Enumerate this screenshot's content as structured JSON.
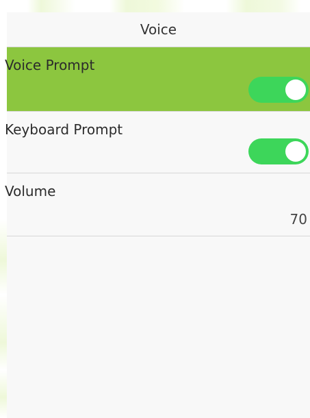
{
  "header": {
    "title": "Voice"
  },
  "settings": [
    {
      "label": "Voice Prompt",
      "control": "toggle",
      "state": "on",
      "selected": true
    },
    {
      "label": "Keyboard Prompt",
      "control": "toggle",
      "state": "on",
      "selected": false
    },
    {
      "label": "Volume",
      "control": "value",
      "value": "70",
      "selected": false
    }
  ],
  "colors": {
    "selection": "#8cc63f",
    "toggle_on": "#3dd65a",
    "background": "#f8f8f8"
  }
}
